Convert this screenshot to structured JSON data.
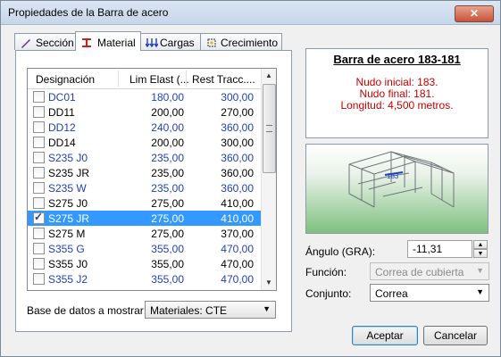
{
  "window": {
    "title": "Propiedades de la Barra de acero",
    "close_label": "✕"
  },
  "tabs": [
    {
      "label": "Sección"
    },
    {
      "label": "Material"
    },
    {
      "label": "Cargas"
    },
    {
      "label": "Crecimiento"
    }
  ],
  "list": {
    "headers": [
      "Designación",
      "Lim Elast (...",
      "Rest Tracc...."
    ],
    "rows": [
      {
        "name": "DC01",
        "lim": "180,00",
        "rest": "300,00",
        "blue": true,
        "checked": false,
        "selected": false
      },
      {
        "name": "DD11",
        "lim": "200,00",
        "rest": "270,00",
        "blue": false,
        "checked": false,
        "selected": false
      },
      {
        "name": "DD12",
        "lim": "240,00",
        "rest": "360,00",
        "blue": true,
        "checked": false,
        "selected": false
      },
      {
        "name": "DD14",
        "lim": "200,00",
        "rest": "300,00",
        "blue": false,
        "checked": false,
        "selected": false
      },
      {
        "name": "S235 J0",
        "lim": "235,00",
        "rest": "360,00",
        "blue": true,
        "checked": false,
        "selected": false
      },
      {
        "name": "S235 JR",
        "lim": "235,00",
        "rest": "360,00",
        "blue": false,
        "checked": false,
        "selected": false
      },
      {
        "name": "S235 W",
        "lim": "235,00",
        "rest": "360,00",
        "blue": true,
        "checked": false,
        "selected": false
      },
      {
        "name": "S275 J0",
        "lim": "275,00",
        "rest": "410,00",
        "blue": false,
        "checked": false,
        "selected": false
      },
      {
        "name": "S275 JR",
        "lim": "275,00",
        "rest": "410,00",
        "blue": false,
        "checked": true,
        "selected": true
      },
      {
        "name": "S275 M",
        "lim": "275,00",
        "rest": "370,00",
        "blue": false,
        "checked": false,
        "selected": false
      },
      {
        "name": "S355 G",
        "lim": "355,00",
        "rest": "470,00",
        "blue": true,
        "checked": false,
        "selected": false
      },
      {
        "name": "S355 J0",
        "lim": "355,00",
        "rest": "470,00",
        "blue": false,
        "checked": false,
        "selected": false
      },
      {
        "name": "S355 J2",
        "lim": "355,00",
        "rest": "470,00",
        "blue": true,
        "checked": false,
        "selected": false
      }
    ]
  },
  "database": {
    "label": "Base de datos a mostrar: ..",
    "value": "Materiales: CTE"
  },
  "description": {
    "title": "Barra de acero 183-181",
    "lines": [
      "Nudo inicial: 183.",
      "Nudo final: 181.",
      "Longitud: 4,500 metros."
    ]
  },
  "preview": {
    "marker_label": "183"
  },
  "angle": {
    "label": "Ángulo (GRA):",
    "value": "-11,31"
  },
  "function": {
    "label": "Función:",
    "value": "Correa de cubierta"
  },
  "set": {
    "label": "Conjunto:",
    "value": "Correa"
  },
  "buttons": {
    "accept": "Aceptar",
    "cancel": "Cancelar"
  },
  "colors": {
    "selection": "#3399ff",
    "blue_text": "#1f3fbf",
    "red_text": "#cc0000"
  }
}
